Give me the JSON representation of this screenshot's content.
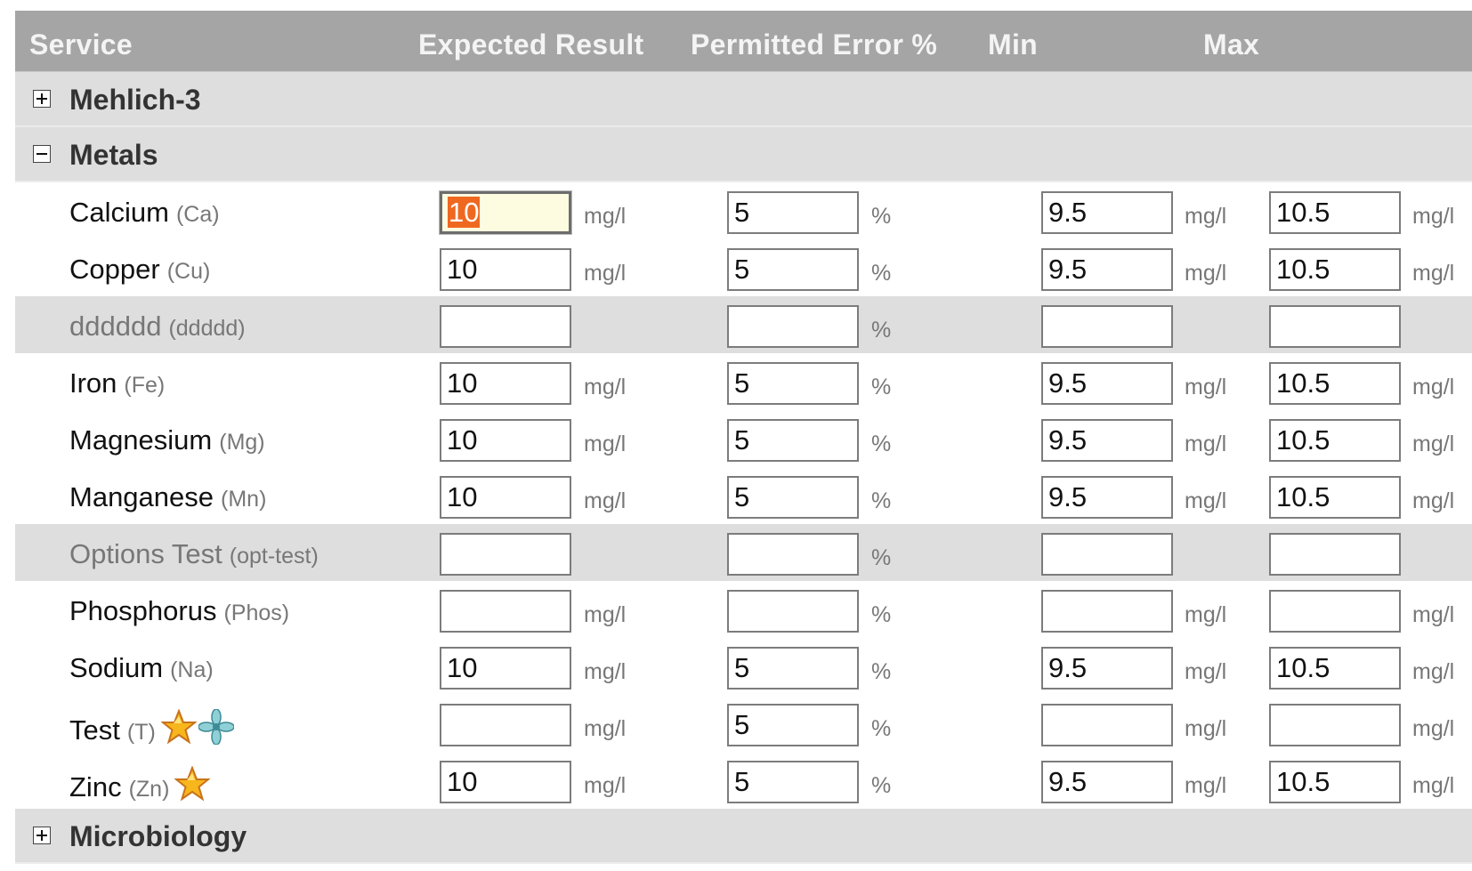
{
  "header": {
    "service": "Service",
    "expected": "Expected Result",
    "error": "Permitted Error %",
    "min": "Min",
    "max": "Max"
  },
  "categories": [
    {
      "label": "Mehlich-3",
      "expanded": false
    },
    {
      "label": "Metals",
      "expanded": true
    },
    {
      "label": "Microbiology",
      "expanded": false
    }
  ],
  "rows": [
    {
      "name": "Calcium",
      "keyword": "(Ca)",
      "expected": "10",
      "expected_unit": "mg/l",
      "error": "5",
      "error_unit": "%",
      "min": "9.5",
      "min_unit": "mg/l",
      "max": "10.5",
      "max_unit": "mg/l",
      "focused": true
    },
    {
      "name": "Copper",
      "keyword": "(Cu)",
      "expected": "10",
      "expected_unit": "mg/l",
      "error": "5",
      "error_unit": "%",
      "min": "9.5",
      "min_unit": "mg/l",
      "max": "10.5",
      "max_unit": "mg/l"
    },
    {
      "name": "dddddd",
      "keyword": "(ddddd)",
      "expected": "",
      "expected_unit": "",
      "error": "",
      "error_unit": "%",
      "min": "",
      "min_unit": "",
      "max": "",
      "max_unit": "",
      "disabled": true
    },
    {
      "name": "Iron",
      "keyword": "(Fe)",
      "expected": "10",
      "expected_unit": "mg/l",
      "error": "5",
      "error_unit": "%",
      "min": "9.5",
      "min_unit": "mg/l",
      "max": "10.5",
      "max_unit": "mg/l"
    },
    {
      "name": "Magnesium",
      "keyword": "(Mg)",
      "expected": "10",
      "expected_unit": "mg/l",
      "error": "5",
      "error_unit": "%",
      "min": "9.5",
      "min_unit": "mg/l",
      "max": "10.5",
      "max_unit": "mg/l"
    },
    {
      "name": "Manganese",
      "keyword": "(Mn)",
      "expected": "10",
      "expected_unit": "mg/l",
      "error": "5",
      "error_unit": "%",
      "min": "9.5",
      "min_unit": "mg/l",
      "max": "10.5",
      "max_unit": "mg/l"
    },
    {
      "name": "Options Test",
      "keyword": "(opt-test)",
      "expected": "",
      "expected_unit": "",
      "error": "",
      "error_unit": "%",
      "min": "",
      "min_unit": "",
      "max": "",
      "max_unit": "",
      "disabled": true
    },
    {
      "name": "Phosphorus",
      "keyword": "(Phos)",
      "expected": "",
      "expected_unit": "mg/l",
      "error": "",
      "error_unit": "%",
      "min": "",
      "min_unit": "mg/l",
      "max": "",
      "max_unit": "mg/l"
    },
    {
      "name": "Sodium",
      "keyword": "(Na)",
      "expected": "10",
      "expected_unit": "mg/l",
      "error": "5",
      "error_unit": "%",
      "min": "9.5",
      "min_unit": "mg/l",
      "max": "10.5",
      "max_unit": "mg/l"
    },
    {
      "name": "Test",
      "keyword": "(T)",
      "expected": "",
      "expected_unit": "mg/l",
      "error": "5",
      "error_unit": "%",
      "min": "",
      "min_unit": "mg/l",
      "max": "",
      "max_unit": "mg/l",
      "icons": [
        "star-icon",
        "fan-icon"
      ]
    },
    {
      "name": "Zinc",
      "keyword": "(Zn)",
      "expected": "10",
      "expected_unit": "mg/l",
      "error": "5",
      "error_unit": "%",
      "min": "9.5",
      "min_unit": "mg/l",
      "max": "10.5",
      "max_unit": "mg/l",
      "icons": [
        "star-icon"
      ]
    }
  ],
  "colors": {
    "header_bg": "#a5a5a5",
    "category_bg": "#dedede",
    "focus_selection": "#ef6820",
    "focus_bg": "#fdfbe0"
  }
}
